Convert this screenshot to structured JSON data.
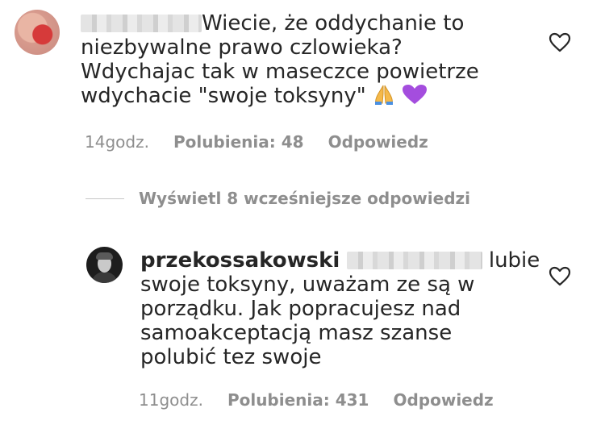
{
  "comment1": {
    "lines": [
      "Wiecie, że oddychanie to",
      "niezbywalne prawo czlowieka?",
      "Wdychajac tak w maseczce powietrze",
      "wdychacie \"swoje toksyny\""
    ],
    "emojis": [
      "folded-hands-emoji",
      "purple-heart-emoji"
    ],
    "time": "14godz.",
    "likes": "Polubienia: 48",
    "reply": "Odpowiedz"
  },
  "view_replies": "Wyświetl 8 wcześniejsze odpowiedzi",
  "comment2": {
    "username": "przekossakowski",
    "lines": [
      "lubie",
      "swoje toksyny, uważam ze są w",
      "porządku. Jak popracujesz nad",
      "samoakceptacją masz szanse",
      "polubić tez swoje"
    ],
    "time": "11godz.",
    "likes": "Polubienia: 431",
    "reply": "Odpowiedz"
  },
  "icons": {
    "like": "heart-outline-icon"
  },
  "colors": {
    "text": "#262626",
    "meta": "#8e8e8e",
    "purple_heart": "#a44dde"
  }
}
